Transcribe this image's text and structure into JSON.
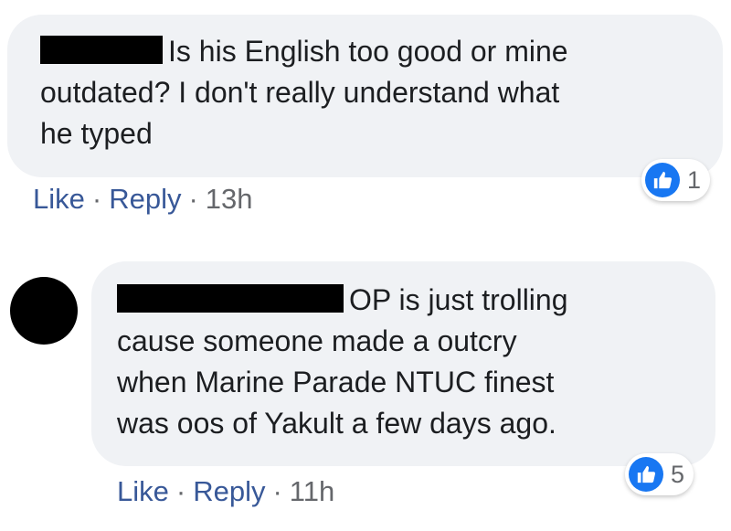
{
  "comments": [
    {
      "text_line_1": "Is his English too good or mine",
      "text_line_2": "outdated? I don't really understand what",
      "text_line_3": "he typed",
      "reaction_count": "1",
      "actions": {
        "like": "Like",
        "separator": "·",
        "reply": "Reply",
        "time": "13h"
      }
    },
    {
      "text_line_1": "OP is just trolling",
      "text_line_2": "cause someone made a outcry",
      "text_line_3": "when Marine Parade NTUC finest",
      "text_line_4": "was oos of Yakult a few days ago.",
      "reaction_count": "5",
      "actions": {
        "like": "Like",
        "separator": "·",
        "reply": "Reply",
        "time": "11h"
      }
    }
  ],
  "colors": {
    "bubble_bg": "#f0f2f5",
    "link": "#385898",
    "meta": "#65676b",
    "like_blue": "#1877f2"
  },
  "icons": {
    "reaction": "thumbs-up-icon"
  }
}
